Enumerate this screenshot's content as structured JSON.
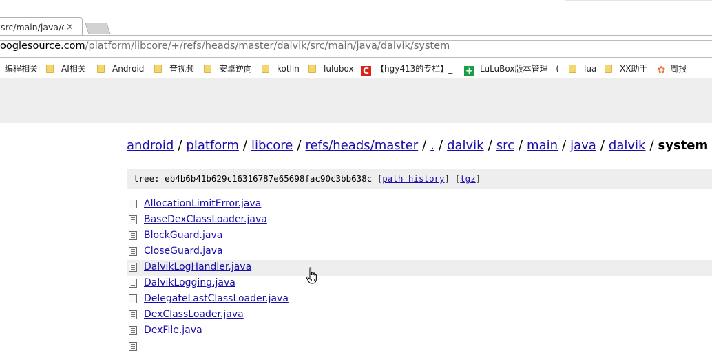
{
  "browser": {
    "tab": {
      "title": "src/main/java/dalvik/system",
      "close_icon": "×"
    },
    "address": {
      "host": "googlesource.com",
      "path": "/platform/libcore/+/refs/heads/master/dalvik/src/main/java/dalvik/system",
      "host_visible": "ooglesource.com"
    },
    "bookmarks": [
      {
        "label": "编程相关",
        "icon": "folder-icon"
      },
      {
        "label": "AI相关",
        "icon": "folder-icon"
      },
      {
        "label": "Android",
        "icon": "folder-icon"
      },
      {
        "label": "音视频",
        "icon": "folder-icon"
      },
      {
        "label": "安卓逆向",
        "icon": "folder-icon"
      },
      {
        "label": "kotlin",
        "icon": "folder-icon"
      },
      {
        "label": "lulubox",
        "icon": "folder-icon"
      },
      {
        "label": "【hgy413的专栏】_",
        "icon": "csdn-icon"
      },
      {
        "label": "LuLuBox版本管理 - (",
        "icon": "plus-icon"
      },
      {
        "label": "lua",
        "icon": "folder-icon"
      },
      {
        "label": "XX助手",
        "icon": "folder-icon"
      },
      {
        "label": "周报",
        "icon": "flower-icon"
      }
    ]
  },
  "breadcrumb": {
    "links": [
      "android",
      "platform",
      "libcore",
      "refs/heads/master",
      ".",
      "dalvik",
      "src",
      "main",
      "java",
      "dalvik"
    ],
    "separator": "/",
    "current": "system"
  },
  "tree": {
    "prefix": "tree:",
    "hash": "eb4b6b41b629c16316787e65698fac90c3bb638c",
    "path_history_label": "path history",
    "tgz_label": "tgz"
  },
  "files": [
    "AllocationLimitError.java",
    "BaseDexClassLoader.java",
    "BlockGuard.java",
    "CloseGuard.java",
    "DalvikLogHandler.java",
    "DalvikLogging.java",
    "DelegateLastClassLoader.java",
    "DexClassLoader.java",
    "DexFile.java"
  ],
  "hovered_file_index": 4
}
